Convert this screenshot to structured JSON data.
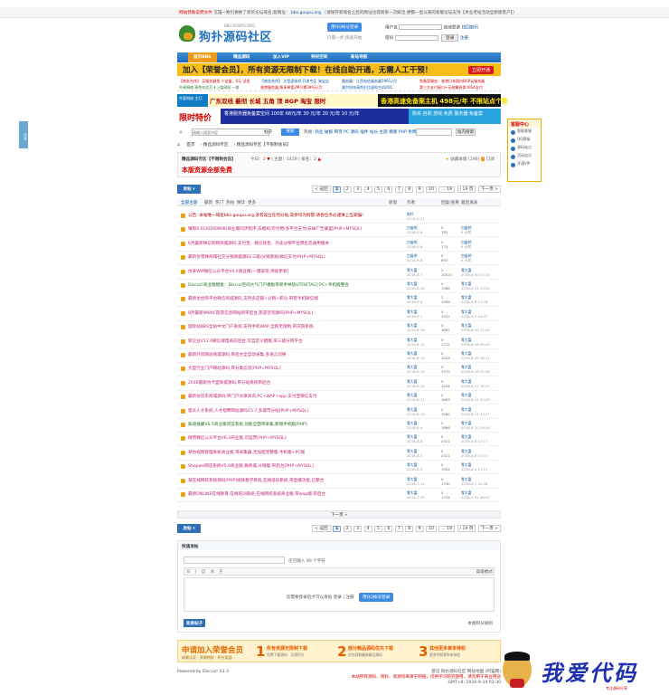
{
  "topbar": {
    "alert": "网站赞助说明文件",
    "text": "沉锚一致们要换了新的论坛域名,新网址：",
    "domain": "bbs.goupu.org",
    "rest": "（请保存新域名之后的网址也得简单一次鲜活,便都一直以来的新版论坛支持【术业老站活动全新版客户】）"
  },
  "logo": {
    "title": "狗扑源码社区",
    "sub": "BBS.GOUPU.ORG"
  },
  "login": {
    "qq_label": "用QQ帐号登录",
    "qq_hint": "只需一步,快速开始",
    "user_label": "用户名",
    "pass_label": "密码",
    "auto": "自动登录",
    "findpwd": "找回密码",
    "login_btn": "登录",
    "register": "注册"
  },
  "nav": [
    "首页BBS",
    "精品源码",
    "加入VIP",
    "特权空间",
    "新站导航"
  ],
  "banner1": {
    "text": "加入【荣誉会员】，所有资源无限制下载！在线自助开通，无需人工干预！",
    "btn": "立即开通"
  },
  "ads": [
    "【商务合作】 买服务器找 小宝盒，0元 试用",
    "【商务合作】 大型虚拟机 开发专区 淘宝店",
    "服务器：江西电信服务器599元/月",
    "免备案服务：香港日本国内BGP云服务器",
    "扑易网络 高性价比打卡上架网站 一群",
    "香港服务器,独享带宽2M只需399元/月",
    "威尔科技高性价比虚拟主机/IDC",
    "第三方支付接口+无结算担保·VISA支付"
  ],
  "banner2": {
    "left": "扑爱网络 主打:",
    "mid": "广东双线 蔽彻 长城 五角 顶 BGP 淘宝 限时",
    "right": "香港高速免备案主机 498元/年 不限站点个数"
  },
  "banner3": {
    "title": "限时特价",
    "mid": "香港服务器免备案空间 100年 68元/年  30 元/年  20 元/年  10 元/年",
    "right": "购买·自助 游戏·免费 服务器·免备案"
  },
  "search": {
    "placeholder": "请输入搜索内容",
    "type": "帖子",
    "btn": "搜索",
    "hot_label": "热搜:",
    "hot": "商业 破解 网页 PC 源码 插件 站长 主题 模版 PHP 免费",
    "btn2": "站内搜索"
  },
  "breadcrumb": [
    "首页",
    "精品源码专区",
    "精品源码专区【不限制会员】"
  ],
  "forum": {
    "name": "精品源码专区【不限制会员】",
    "today": "今日：1",
    "topics": "主题：1429",
    "rank": "排名：2",
    "fav": "收藏本版 (196)",
    "rss": "订阅",
    "rule": "本版资源全部免费"
  },
  "post_btn": "发帖",
  "pages": {
    "prev": "< 返回",
    "items": [
      "1",
      "2",
      "3",
      "4",
      "5",
      "6",
      "7",
      "8",
      "9",
      "10",
      "... 19"
    ],
    "total": "/ 19 页",
    "next": "下一页 >"
  },
  "thead": {
    "filter": "全部主题",
    "tabs": [
      "最新",
      "热门",
      "热帖",
      "精华",
      "更多"
    ],
    "new": "新窗",
    "author": "作者",
    "replies": "回复/查看",
    "last": "最后发表"
  },
  "threads": [
    {
      "title": "公告: 本站唯一域名bbs.goupu.org,没有设立任何分站,其余均为假冒,请各位务必谨慎上当受骗!",
      "author": "狗扑",
      "adate": "2014-5-21",
      "nums": "",
      "last": "",
      "ldate": "",
      "color": "#b00000"
    },
    {
      "title": "镇帮0.0(20160908)商业版同步程序,去版权/可付费/多平台支付/去掉广告联盟[PHP+MYSQL]",
      "author": "白雀吧",
      "adate": "2016-9-8",
      "nums": "0\n783",
      "last": "白雀吧",
      "ldate": "6 天前",
      "color": "#c02070"
    },
    {
      "title": "6月最新微信购物商城源码,支付宝、微信钱包、外卖分销平台原生态通用版本",
      "author": "白雀吧",
      "adate": "2016-9-8",
      "nums": "0\n774",
      "last": "白雀吧",
      "ldate": "6 天前",
      "color": "#c02070"
    },
    {
      "title": "最新仿雪球商城社交分销商城源码(三级/分销系统/微信支付/PHP+MYSQL)",
      "author": "白雀吧",
      "adate": "2016-9-8",
      "nums": "0\n653",
      "last": "白雀吧",
      "ldate": "6 天前",
      "color": "#c02070"
    },
    {
      "title": "仿某WM微信公众平台V4.0商业版[一键安装,持续更新]",
      "author": "零大富",
      "adate": "2016-8-7",
      "nums": "2\n10021",
      "last": "零大富",
      "ldate": "2016-8-10 22:15",
      "color": "#c02070"
    },
    {
      "title": "Discuz!商业版模板：Discuz空间大气门户模板带新手导航UTF8[TAG] PC+手机版整合",
      "author": "零大富",
      "adate": "2016-8-30",
      "nums": "0\n1588",
      "last": "零大富",
      "ldate": "2016-8-31 13:22",
      "color": "#207020"
    },
    {
      "title": "最新仿合购平台微信商城源码,支持多店铺+分销+积分,带有手机微信端",
      "author": "零大富",
      "adate": "2016-9-5",
      "nums": "2\n1569",
      "last": "零大富",
      "ldate": "2016-9-6 11:28",
      "color": "#c02070"
    },
    {
      "title": "8月最新WKNC旅游信息网站新带后台,旅游咨询源码[PHP+MYSQL]",
      "author": "零大富",
      "adate": "2016-9-1",
      "nums": "0\n1522",
      "last": "零大富",
      "ldate": "2016-9-2 10:47",
      "color": "#c02070"
    },
    {
      "title": "国际站BBS全站中文门户系统,支持手机WAP,全民无限制,带充值系统",
      "author": "零大富",
      "adate": "2016-8-19",
      "nums": "0\n1667",
      "last": "零大富",
      "ldate": "2016-8-20 11:04",
      "color": "#c02070"
    },
    {
      "title": "新企业V12.0微信端电商前后台,可自定义模版,带三级分销平台",
      "author": "零大富",
      "adate": "2016-8-15",
      "nums": "0\n1712",
      "last": "零大富",
      "ldate": "2016-8-16 09:40",
      "color": "#c02070"
    },
    {
      "title": "最新外贸网站商城源码,带后台全自动采集,多语言切换",
      "author": "零大富",
      "adate": "2016-8-15",
      "nums": "0\n1403",
      "last": "零大富",
      "ldate": "2016-8-16 18:11",
      "color": "#c02070"
    },
    {
      "title": "大型行业门户网站源码,带分类信息[PHP+MYSQL]",
      "author": "零大富",
      "adate": "2016-8-15",
      "nums": "0\n1575",
      "last": "零大富",
      "ldate": "2016-8-16 21:04",
      "color": "#c02070"
    },
    {
      "title": "2016最新仿卡盟商城源码,带分站系统带后台",
      "author": "零大富",
      "adate": "2016-8-12",
      "nums": "0\n1254",
      "last": "零大富",
      "ldate": "2016-8-13 16:23",
      "color": "#c02070"
    },
    {
      "title": "最新仿京东商城源码,带门户文章资讯,PC+WAP+app,支付宝微信支付",
      "author": "零大富",
      "adate": "2016-8-11",
      "nums": "0\n1663",
      "last": "零大富",
      "ldate": "2016-8-12 10:09",
      "color": "#c02070"
    },
    {
      "title": "猎头人才系统,人才招聘网站源码V3.7,多城市分站[PHP+MYSQL]",
      "author": "零大富",
      "adate": "2016-8-10",
      "nums": "0\n1560",
      "last": "零大富",
      "ldate": "2016-8-11 14:37",
      "color": "#c02070"
    },
    {
      "title": "知道搜藏V6.5商业版问答系统,功能全面带采集,新增手机版[PHP]",
      "author": "零大富",
      "adate": "2016-8-9",
      "nums": "0\n1686",
      "last": "零大富",
      "ldate": "2016-8-10 09:34",
      "color": "#207020"
    },
    {
      "title": "微赞微信公众平台V6.3商业版,可运营[PHP+MYSQL]",
      "author": "零大富",
      "adate": "2016-8-8",
      "nums": "0\n4321",
      "last": "零大富",
      "ldate": "2016-8-8 17:17",
      "color": "#c02070"
    },
    {
      "title": "某仿视频管理系统商业版,带采集器,无加密完整版,手机端+PC端",
      "author": "零大富",
      "adate": "2016-8-5",
      "nums": "0\n2521",
      "last": "零大富",
      "ldate": "2016-8-6 11:31",
      "color": "#c02070"
    },
    {
      "title": "Shopwe网店系统V5.0商业版,微商城,分销版,带后台[PHP+MYSQL]",
      "author": "零大富",
      "adate": "2016-8-3",
      "nums": "0\n1504",
      "last": "零大富",
      "ldate": "2016-8-4 12:11",
      "color": "#c02070"
    },
    {
      "title": "某在线网校系统源码[PHP]视频教学系统,在线培训系统,带直播功能,已整合",
      "author": "零大富",
      "adate": "2016-7-31",
      "nums": "0\n1730",
      "last": "零大富",
      "ldate": "2016-8-1 10:48",
      "color": "#c02070"
    },
    {
      "title": "最新ONLINE在线教育,在线培训系统,在线网校系统商业版,带wap端,带后台",
      "author": "零大富",
      "adate": "2016-7-30",
      "nums": "0\n1734",
      "last": "零大富",
      "ldate": "2016-7-31 08:51",
      "color": "#c02070"
    }
  ],
  "next_page": "下一页 »",
  "quickpost": {
    "header": "快速发帖",
    "title_note": "还可输入 80 个字符",
    "mode": "高级模式",
    "login_text": "您需要登录后才可以发帖  登录 | 注册",
    "qq_btn": "用QQ帐号登录",
    "submit": "发表帖子",
    "arrange": "本版积分规则"
  },
  "vip": {
    "title": "申请加入荣誉会员",
    "sub": "成就认证 · 资源特权 · 积分奖励",
    "steps": [
      {
        "n": "1",
        "a": "所有资源无限制下载",
        "c": "免费下载源码 · 无需积分"
      },
      {
        "n": "2",
        "a": "部分精品源码优先下载",
        "c": "优先获取最新精品源码"
      },
      {
        "n": "3",
        "a": "其他更多尊享特权",
        "c": "更多特权等你来体验"
      }
    ]
  },
  "footer": {
    "powered": "Powered by Discuz! X3.3",
    "links": "意见  狗扑源码社区  网站地图  (阿猫网)",
    "note": "本站所有源码、资料、资源均来源于网络，仅供学习研究使用，请勿用于商业用途",
    "time": "GMT+8, 2016-9-14 03:30"
  },
  "side_tab": "分享",
  "kefu": {
    "title": "客服中心",
    "items": [
      "智能客服",
      "QQ客服",
      "源码站点",
      "活动站点",
      "开通VIP"
    ]
  },
  "watermark": {
    "text": "我爱代码",
    "url": "专注源码分享"
  }
}
